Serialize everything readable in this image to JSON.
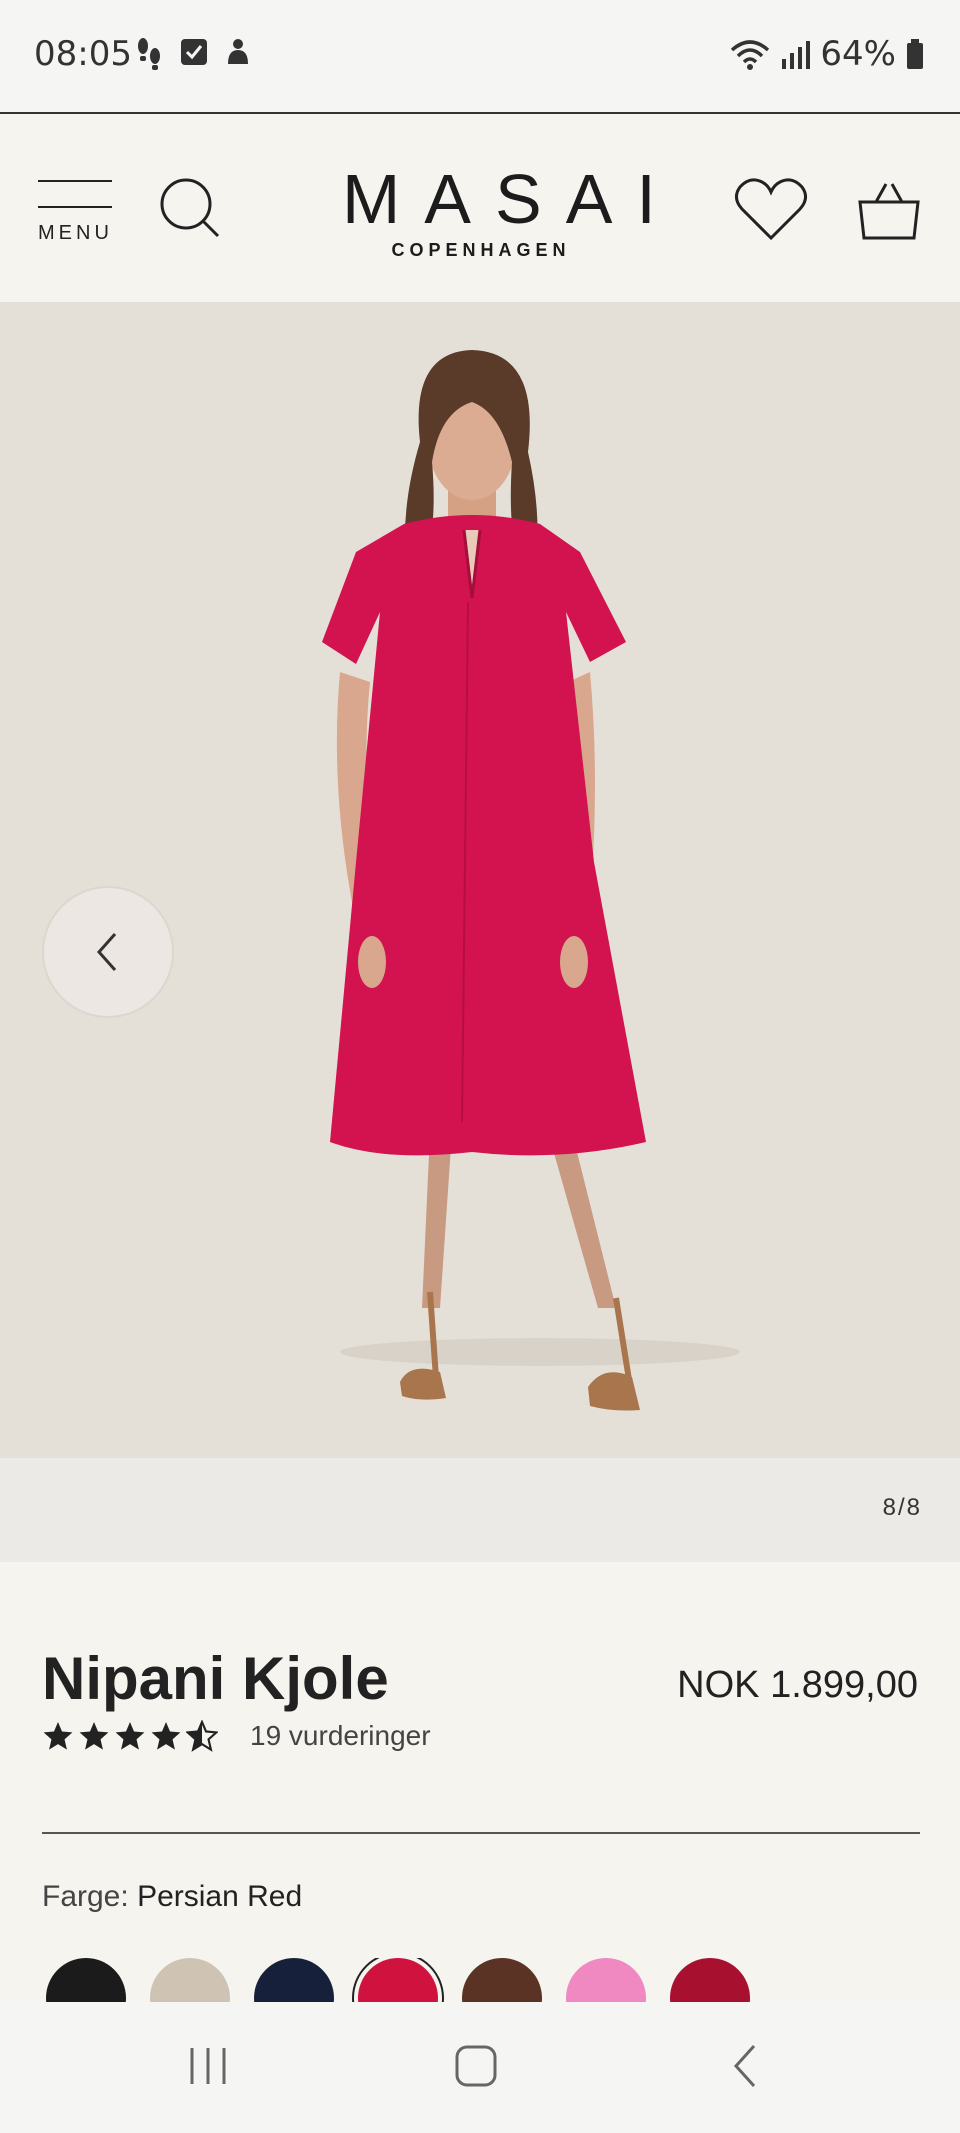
{
  "status_bar": {
    "time": "08:05",
    "battery": "64%",
    "left_icons": [
      "footsteps-icon",
      "checkbox-icon",
      "notification-icon"
    ],
    "right_icons": [
      "wifi-icon",
      "signal-icon",
      "battery-icon"
    ]
  },
  "header": {
    "menu_label": "MENU",
    "logo_main": "MASAI",
    "logo_sub": "COPENHAGEN"
  },
  "gallery": {
    "counter": "8/8",
    "photo_description_icon": "product-photo",
    "background_color": "#e5e0d7",
    "dress_color": "#d2134f"
  },
  "product": {
    "title": "Nipani Kjole",
    "price": "NOK 1.899,00",
    "rating_value": 4.5,
    "rating_max": 5,
    "rating_count": "19 vurderinger",
    "color_label": "Farge:",
    "color_value": "Persian Red",
    "swatches": [
      {
        "color": "#1b1b1b",
        "selected": false
      },
      {
        "color": "#cfc3b3",
        "selected": false
      },
      {
        "color": "#17203a",
        "selected": false
      },
      {
        "color": "#d0123f",
        "selected": true
      },
      {
        "color": "#5b3324",
        "selected": false
      },
      {
        "color": "#f088c2",
        "selected": false
      },
      {
        "color": "#a8102f",
        "selected": false
      }
    ]
  },
  "nav_bar": {
    "buttons": [
      "recent-apps-icon",
      "home-icon",
      "back-icon"
    ]
  }
}
